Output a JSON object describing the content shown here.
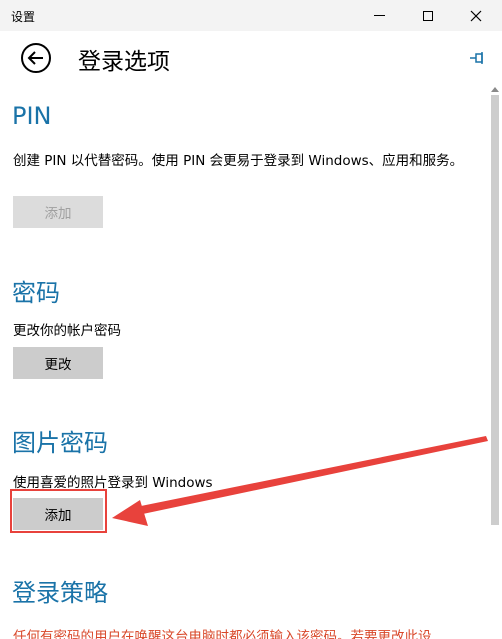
{
  "window": {
    "title": "设置"
  },
  "header": {
    "title": "登录选项"
  },
  "icons": {
    "back": "back-arrow-icon",
    "pin": "pin-icon",
    "minimize": "minimize-icon",
    "maximize": "maximize-icon",
    "close": "close-icon"
  },
  "sections": {
    "pin": {
      "heading": "PIN",
      "description": "创建 PIN 以代替密码。使用 PIN 会更易于登录到 Windows、应用和服务。",
      "button": "添加"
    },
    "password": {
      "heading": "密码",
      "description": "更改你的帐户密码",
      "button": "更改"
    },
    "picture_password": {
      "heading": "图片密码",
      "description": "使用喜爱的照片登录到 Windows",
      "button": "添加"
    },
    "policy": {
      "heading": "登录策略",
      "description": "任何有密码的用户在唤醒这台电脑时都必须输入该密码。若要更改此设"
    }
  },
  "colors": {
    "accent": "#1a73a8",
    "annotation": "#e8423c",
    "warning_text": "#d9482a"
  }
}
